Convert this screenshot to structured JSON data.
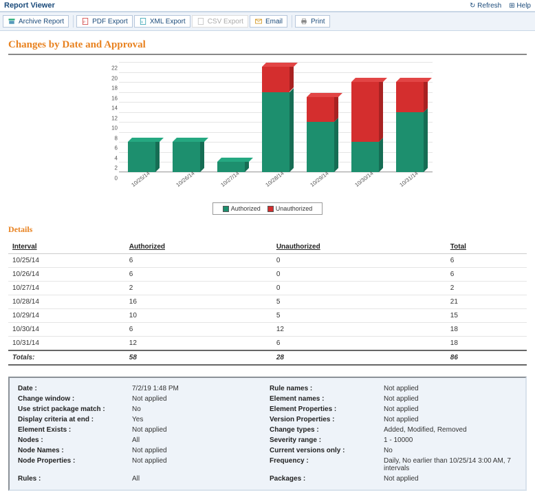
{
  "header": {
    "app_title": "Report Viewer",
    "refresh": "Refresh",
    "help": "Help"
  },
  "toolbar": {
    "archive": "Archive Report",
    "pdf": "PDF Export",
    "xml": "XML Export",
    "csv": "CSV Export",
    "email": "Email",
    "print": "Print"
  },
  "report": {
    "title": "Changes by Date and Approval",
    "details_label": "Details"
  },
  "legend": {
    "authorized": "Authorized",
    "unauthorized": "Unauthorized"
  },
  "table": {
    "columns": {
      "interval": "Interval",
      "auth": "Authorized",
      "unauth": "Unauthorized",
      "total": "Total"
    },
    "rows": [
      {
        "interval": "10/25/14",
        "auth": 6,
        "unauth": 0,
        "total": 6
      },
      {
        "interval": "10/26/14",
        "auth": 6,
        "unauth": 0,
        "total": 6
      },
      {
        "interval": "10/27/14",
        "auth": 2,
        "unauth": 0,
        "total": 2
      },
      {
        "interval": "10/28/14",
        "auth": 16,
        "unauth": 5,
        "total": 21
      },
      {
        "interval": "10/29/14",
        "auth": 10,
        "unauth": 5,
        "total": 15
      },
      {
        "interval": "10/30/14",
        "auth": 6,
        "unauth": 12,
        "total": 18
      },
      {
        "interval": "10/31/14",
        "auth": 12,
        "unauth": 6,
        "total": 18
      }
    ],
    "totals": {
      "label": "Totals:",
      "auth": 58,
      "unauth": 28,
      "total": 86
    }
  },
  "chart_data": {
    "type": "bar",
    "stacked": true,
    "categories": [
      "10/25/14",
      "10/26/14",
      "10/27/14",
      "10/28/14",
      "10/29/14",
      "10/30/14",
      "10/31/14"
    ],
    "series": [
      {
        "name": "Authorized",
        "color": "#1d8f6e",
        "values": [
          6,
          6,
          2,
          16,
          10,
          6,
          12
        ]
      },
      {
        "name": "Unauthorized",
        "color": "#d42e2e",
        "values": [
          0,
          0,
          0,
          5,
          5,
          12,
          6
        ]
      }
    ],
    "ylim": [
      0,
      22
    ],
    "yticks": [
      0,
      2,
      4,
      6,
      8,
      10,
      12,
      14,
      16,
      18,
      20,
      22
    ],
    "xlabel": "",
    "ylabel": "",
    "title": ""
  },
  "params": {
    "left": [
      {
        "k": "Date :",
        "v": "7/2/19 1:48 PM"
      },
      {
        "k": "Change window :",
        "v": "Not applied"
      },
      {
        "k": "Use strict package match :",
        "v": "No"
      },
      {
        "k": "Display criteria at end :",
        "v": "Yes"
      },
      {
        "k": "Element Exists :",
        "v": "Not applied"
      },
      {
        "k": "Nodes :",
        "v": "All"
      },
      {
        "k": "Node Names :",
        "v": "Not applied"
      },
      {
        "k": "Node Properties :",
        "v": "Not applied"
      },
      {
        "k": "Rules :",
        "v": "All"
      }
    ],
    "right": [
      {
        "k": "Rule names :",
        "v": "Not applied"
      },
      {
        "k": "Element names :",
        "v": "Not applied"
      },
      {
        "k": "Element Properties :",
        "v": "Not applied"
      },
      {
        "k": "Version Properties :",
        "v": "Not applied"
      },
      {
        "k": "Change types :",
        "v": "Added, Modified, Removed"
      },
      {
        "k": "Severity range :",
        "v": "1 - 10000"
      },
      {
        "k": "Current versions only :",
        "v": "No"
      },
      {
        "k": "Frequency :",
        "v": "Daily, No earlier than 10/25/14 3:00 AM, 7 intervals"
      },
      {
        "k": "Packages :",
        "v": "Not applied"
      }
    ]
  }
}
